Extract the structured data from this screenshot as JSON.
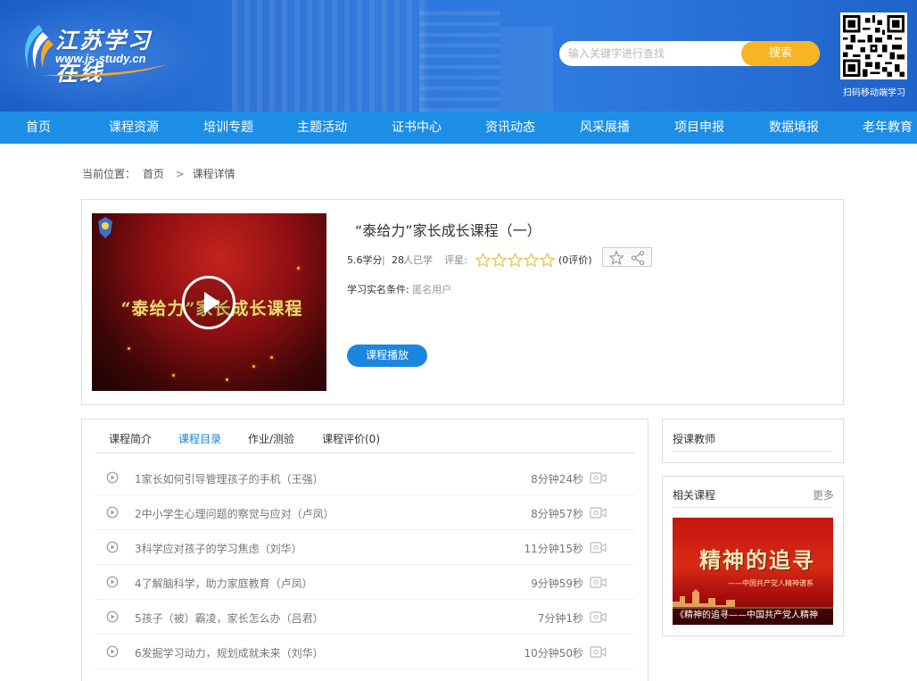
{
  "site": {
    "logo_cn": "江苏学习在线",
    "logo_url": "www.js-study.cn"
  },
  "search": {
    "placeholder": "输入关键字进行查找",
    "button_label": "搜索"
  },
  "qr": {
    "caption": "扫码移动端学习"
  },
  "nav": {
    "items": [
      {
        "label": "首页"
      },
      {
        "label": "课程资源"
      },
      {
        "label": "培训专题"
      },
      {
        "label": "主题活动"
      },
      {
        "label": "证书中心"
      },
      {
        "label": "资讯动态"
      },
      {
        "label": "风采展播"
      },
      {
        "label": "项目申报"
      },
      {
        "label": "数据填报"
      },
      {
        "label": "老年教育"
      }
    ]
  },
  "breadcrumb": {
    "prefix": "当前位置：",
    "home": "首页",
    "separator": ">",
    "current": "课程详情"
  },
  "course": {
    "title": "“泰给力”家长成长课程（一）",
    "thumb_title": "“泰给力”家长成长课程",
    "credits": "5.6学分",
    "divider": "|",
    "learners_count": "28",
    "learners_suffix": "人已学",
    "rating_label": "评星:",
    "rating_count": "(0评价)",
    "rating_stars": 0,
    "condition_label": "学习实名条件:",
    "condition_value": "匿名用户",
    "play_button": "课程播放"
  },
  "tabs": [
    {
      "label": "课程简介",
      "active": false
    },
    {
      "label": "课程目录",
      "active": true
    },
    {
      "label": "作业/测验",
      "active": false
    },
    {
      "label": "课程评价(0)",
      "active": false
    }
  ],
  "catalog": [
    {
      "name": "1家长如何引导管理孩子的手机（王强）",
      "duration": "8分钟24秒"
    },
    {
      "name": "2中小学生心理问题的察觉与应对（卢凤）",
      "duration": "8分钟57秒"
    },
    {
      "name": "3科学应对孩子的学习焦虑（刘华）",
      "duration": "11分钟15秒"
    },
    {
      "name": "4了解脑科学，助力家庭教育（卢凤）",
      "duration": "9分钟59秒"
    },
    {
      "name": "5孩子（被）霸凌，家长怎么办（吕君）",
      "duration": "7分钟1秒"
    },
    {
      "name": "6发掘学习动力，规划成就未来（刘华）",
      "duration": "10分钟50秒"
    }
  ],
  "teacher": {
    "heading": "授课教师"
  },
  "related": {
    "heading": "相关课程",
    "more": "更多",
    "thumb_title": "精神的追寻",
    "thumb_subtitle": "——中国共产党人精神谱系",
    "caption": "《精神的追寻——中国共产党人精神"
  },
  "colors": {
    "header_blue": "#1f66cf",
    "nav_blue": "#1d8ee6",
    "search_button": "#f7b526",
    "play_button": "#1b86e0",
    "active_tab": "#1b7fd6"
  }
}
